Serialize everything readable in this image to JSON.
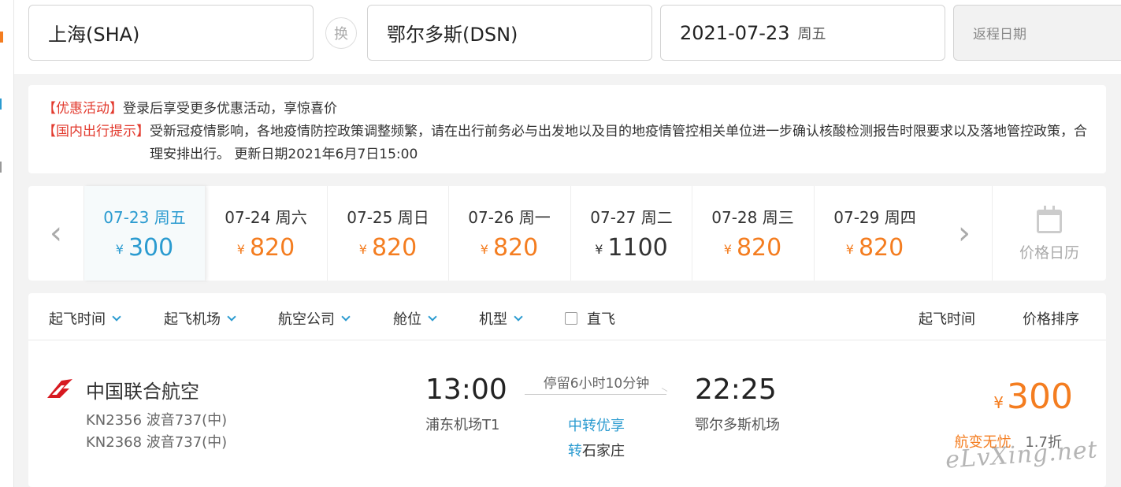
{
  "search": {
    "from": "上海(SHA)",
    "swap_label": "换",
    "to": "鄂尔多斯(DSN)",
    "depart_date": "2021-07-23",
    "depart_weekday": "周五",
    "return_placeholder": "返程日期"
  },
  "notice": {
    "promo_tag": "【优惠活动】",
    "promo_text": "登录后享受更多优惠活动，享惊喜价",
    "travel_tag": "【国内出行提示】",
    "travel_text": "受新冠疫情影响，各地疫情防控政策调整频繁，请在出行前务必与出发地以及目的地疫情管控相关单位进一步确认核酸检测报告时限要求以及落地管控政策，合理安排出行。 更新日期2021年6月7日15:00"
  },
  "date_strip": {
    "prev_icon": "chevron-left-icon",
    "next_icon": "chevron-right-icon",
    "currency": "¥",
    "days": [
      {
        "date": "07-23 周五",
        "price": "300",
        "selected": true
      },
      {
        "date": "07-24 周六",
        "price": "820"
      },
      {
        "date": "07-25 周日",
        "price": "820"
      },
      {
        "date": "07-26 周一",
        "price": "820"
      },
      {
        "date": "07-27 周二",
        "price": "1100",
        "muted": true
      },
      {
        "date": "07-28 周三",
        "price": "820"
      },
      {
        "date": "07-29 周四",
        "price": "820"
      }
    ],
    "calendar_label": "价格日历"
  },
  "filters": {
    "dep_time": "起飞时间",
    "dep_airport": "起飞机场",
    "airline": "航空公司",
    "cabin": "舱位",
    "aircraft": "机型",
    "direct": "直飞",
    "sort_time": "起飞时间",
    "sort_price": "价格排序"
  },
  "flight": {
    "airline": "中国联合航空",
    "flight_no_1": "KN2356 波音737(中)",
    "flight_no_2": "KN2368 波音737(中)",
    "dep_time": "13:00",
    "dep_airport": "浦东机场T1",
    "stopover": "停留6小时10分钟",
    "promo": "中转优享",
    "transit_prefix": "转",
    "transit_city": "石家庄",
    "arr_time": "22:25",
    "arr_airport": "鄂尔多斯机场",
    "currency": "¥",
    "price": "300",
    "insurance": "航变无忧",
    "discount": "1.7折"
  },
  "watermark": "eLvXing.net",
  "colors": {
    "accent_blue": "#2b9bd0",
    "price_orange": "#f47d20",
    "notice_red": "#e23a2e"
  }
}
